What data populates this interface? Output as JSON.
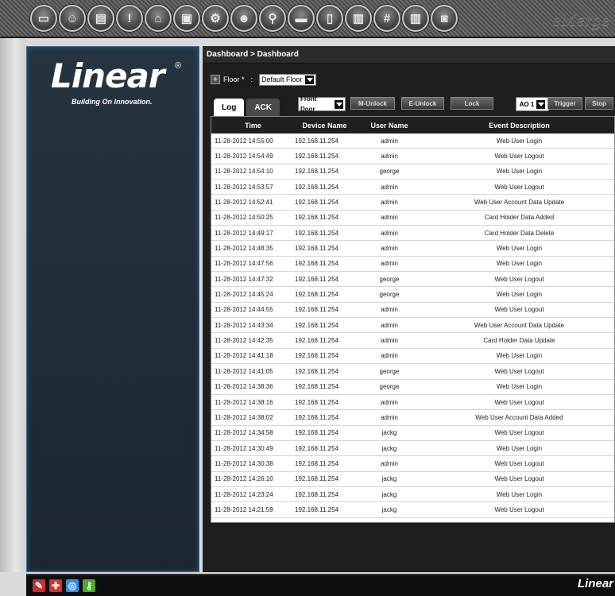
{
  "toolbar": {
    "buttons": [
      {
        "icon": "monitor-icon",
        "glyph": "▭"
      },
      {
        "icon": "users-icon",
        "glyph": "☺"
      },
      {
        "icon": "id-card-icon",
        "glyph": "▤"
      },
      {
        "icon": "alert-icon",
        "glyph": "!"
      },
      {
        "icon": "door-icon",
        "glyph": "⌂"
      },
      {
        "icon": "access-icon",
        "glyph": "▣"
      },
      {
        "icon": "settings-icon",
        "glyph": "⚙"
      },
      {
        "icon": "user-access-icon",
        "glyph": "☻"
      },
      {
        "icon": "network-icon",
        "glyph": "⚲"
      },
      {
        "icon": "storage-icon",
        "glyph": "▬"
      },
      {
        "icon": "document-icon",
        "glyph": "▯"
      },
      {
        "icon": "reports-icon",
        "glyph": "▥"
      },
      {
        "icon": "keypad-icon",
        "glyph": "#"
      },
      {
        "icon": "building-icon",
        "glyph": "▥"
      },
      {
        "icon": "panel-icon",
        "glyph": "◙"
      }
    ],
    "brand": "eMerge"
  },
  "sidebar": {
    "logo": "Linear",
    "registered": "®",
    "tagline": "Building On Innovation."
  },
  "main": {
    "breadcrumb": "Dashboard > Dashboard",
    "floor_label": "Floor *",
    "floor_colon": ":",
    "floor_value": "Default Floor",
    "tabs": [
      "Log",
      "ACK"
    ],
    "door_select": "Front Door",
    "buttons": {
      "m_unlock": "M-Unlock",
      "e_unlock": "E-Unlock",
      "lock": "Lock",
      "trigger": "Trigger",
      "stop": "Stop"
    },
    "ao_select": "AO 1",
    "columns": {
      "time": "Time",
      "device": "Device Name",
      "user": "User Name",
      "event": "Event Description"
    },
    "rows": [
      {
        "time": "11-28-2012 14:55:00",
        "device": "192.168.11.254",
        "user": "admin",
        "event": "Web User Login"
      },
      {
        "time": "11-28-2012 14:54:49",
        "device": "192.168.11.254",
        "user": "admin",
        "event": "Web User Logout"
      },
      {
        "time": "11-28-2012 14:54:10",
        "device": "192.168.11.254",
        "user": "george",
        "event": "Web User Login"
      },
      {
        "time": "11-28-2012 14:53:57",
        "device": "192.168.11.254",
        "user": "admin",
        "event": "Web User Logout"
      },
      {
        "time": "11-28-2012 14:52:41",
        "device": "192.168.11.254",
        "user": "admin",
        "event": "Web User Account Data Update"
      },
      {
        "time": "11-28-2012 14:50:25",
        "device": "192.168.11.254",
        "user": "admin",
        "event": "Card Holder Data Added"
      },
      {
        "time": "11-28-2012 14:49:17",
        "device": "192.168.11.254",
        "user": "admin",
        "event": "Card Holder Data Delete"
      },
      {
        "time": "11-28-2012 14:48:35",
        "device": "192.168.11.254",
        "user": "admin",
        "event": "Web User Login"
      },
      {
        "time": "11-28-2012 14:47:56",
        "device": "192.168.11.254",
        "user": "admin",
        "event": "Web User Login"
      },
      {
        "time": "11-28-2012 14:47:32",
        "device": "192.168.11.254",
        "user": "george",
        "event": "Web User Logout"
      },
      {
        "time": "11-28-2012 14:45:24",
        "device": "192.168.11.254",
        "user": "george",
        "event": "Web User Login"
      },
      {
        "time": "11-28-2012 14:44:55",
        "device": "192.168.11.254",
        "user": "admin",
        "event": "Web User Logout"
      },
      {
        "time": "11-28-2012 14:43:34",
        "device": "192.168.11.254",
        "user": "admin",
        "event": "Web User Account Data Update"
      },
      {
        "time": "11-28-2012 14:42:35",
        "device": "192.168.11.254",
        "user": "admin",
        "event": "Card Holder Data Update"
      },
      {
        "time": "11-28-2012 14:41:18",
        "device": "192.168.11.254",
        "user": "admin",
        "event": "Web User Login"
      },
      {
        "time": "11-28-2012 14:41:05",
        "device": "192.168.11.254",
        "user": "george",
        "event": "Web User Logout"
      },
      {
        "time": "11-28-2012 14:38:36",
        "device": "192.168.11.254",
        "user": "george",
        "event": "Web User Login"
      },
      {
        "time": "11-28-2012 14:38:16",
        "device": "192.168.11.254",
        "user": "admin",
        "event": "Web User Logout"
      },
      {
        "time": "11-28-2012 14:38:02",
        "device": "192.168.11.254",
        "user": "admin",
        "event": "Web User Account Data Added"
      },
      {
        "time": "11-28-2012 14:34:58",
        "device": "192.168.11.254",
        "user": "jackg",
        "event": "Web User Logout"
      },
      {
        "time": "11-28-2012 14:30:49",
        "device": "192.168.11.254",
        "user": "jackg",
        "event": "Web User Login"
      },
      {
        "time": "11-28-2012 14:30:38",
        "device": "192.168.11.254",
        "user": "admin",
        "event": "Web User Logout"
      },
      {
        "time": "11-28-2012 14:26:10",
        "device": "192.168.11.254",
        "user": "jackg",
        "event": "Web User Logout"
      },
      {
        "time": "11-28-2012 14:23:24",
        "device": "192.168.11.254",
        "user": "jackg",
        "event": "Web User Login"
      },
      {
        "time": "11-28-2012 14:21:59",
        "device": "192.168.11.254",
        "user": "jackg",
        "event": "Web User Logout"
      }
    ]
  },
  "bottom": {
    "icons": [
      {
        "icon": "tools-icon",
        "glyph": "✎",
        "color": "#c83030"
      },
      {
        "icon": "medical-cross-icon",
        "glyph": "✚",
        "color": "#d83030"
      },
      {
        "icon": "globe-icon",
        "glyph": "◎",
        "color": "#3a8fd8"
      },
      {
        "icon": "key-icon",
        "glyph": "⚷",
        "color": "#4aaa30"
      }
    ],
    "brand": "Linear"
  }
}
